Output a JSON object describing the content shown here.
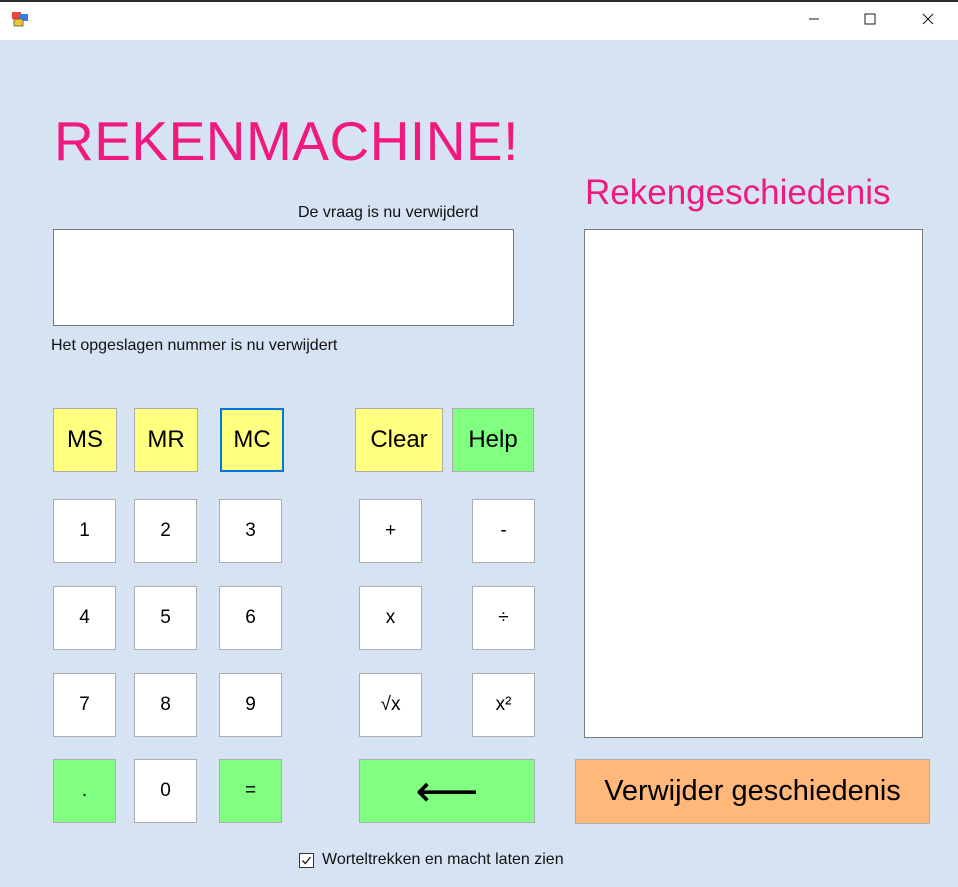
{
  "window": {
    "icons": {
      "app": "app-icon",
      "minimize": "minimize-icon",
      "maximize": "maximize-icon",
      "close": "close-icon"
    }
  },
  "header": {
    "title": "REKENMACHINE!",
    "history_title": "Rekengeschiedenis"
  },
  "status": {
    "question_message": "De vraag is nu verwijderd",
    "memory_message": "Het opgeslagen nummer is nu verwijdert"
  },
  "display": {
    "value": ""
  },
  "history": {
    "items": []
  },
  "memory": {
    "ms": "MS",
    "mr": "MR",
    "mc": "MC"
  },
  "controls": {
    "clear": "Clear",
    "help": "Help"
  },
  "digits": {
    "d1": "1",
    "d2": "2",
    "d3": "3",
    "d4": "4",
    "d5": "5",
    "d6": "6",
    "d7": "7",
    "d8": "8",
    "d9": "9",
    "d0": "0",
    "dot": ".",
    "equals": "="
  },
  "operators": {
    "plus": "+",
    "minus": "-",
    "multiply": "x",
    "divide": "÷",
    "sqrt": "√x",
    "square": "x²",
    "backspace": "⟵"
  },
  "clear_history": "Verwijder geschiedenis",
  "options": {
    "show_advanced_label": "Worteltrekken en macht laten zien",
    "show_advanced_checked": true
  },
  "colors": {
    "title": "#f0197d",
    "background": "#d6e3f2",
    "memory_buttons": "#ffff80",
    "green_buttons": "#80ff80",
    "orange_button": "#ffb87a",
    "focus": "#0078d7"
  }
}
